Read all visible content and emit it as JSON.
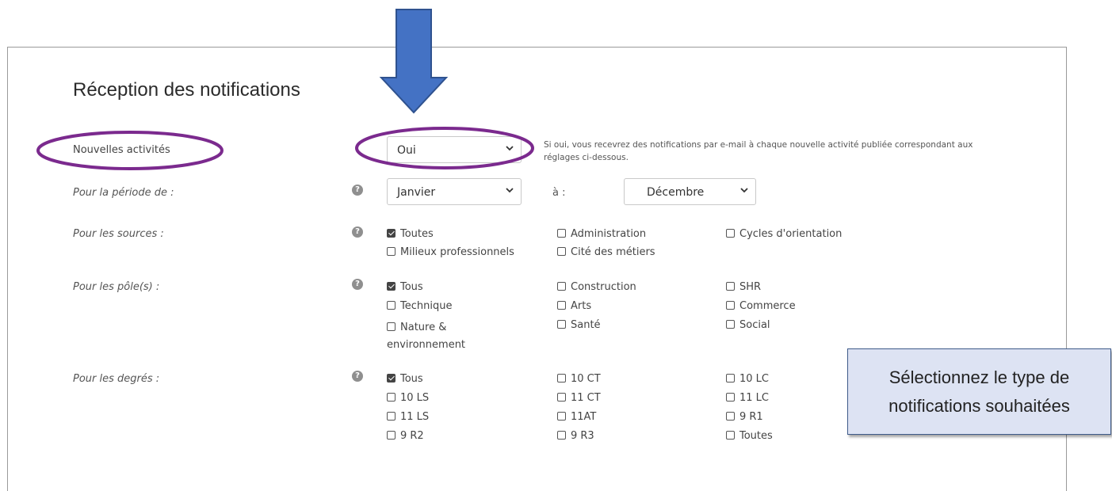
{
  "title": "Réception des notifications",
  "rows": {
    "nouvelles": {
      "label": "Nouvelles activités",
      "select_value": "Oui",
      "note": "Si oui, vous recevrez des notifications par e-mail à chaque nouvelle activité publiée correspondant aux réglages ci-dessous."
    },
    "periode": {
      "label": "Pour la période de :",
      "from_value": "Janvier",
      "separator": "à :",
      "to_value": "Décembre"
    },
    "sources": {
      "label": "Pour les sources :",
      "options": [
        {
          "label": "Toutes",
          "checked": true
        },
        {
          "label": "Administration",
          "checked": false
        },
        {
          "label": "Cycles d'orientation",
          "checked": false
        },
        {
          "label": "Milieux professionnels",
          "checked": false
        },
        {
          "label": "Cité des métiers",
          "checked": false
        }
      ]
    },
    "poles": {
      "label": "Pour les pôle(s) :",
      "options": [
        {
          "label": "Tous",
          "checked": true
        },
        {
          "label": "Construction",
          "checked": false
        },
        {
          "label": "SHR",
          "checked": false
        },
        {
          "label": "Technique",
          "checked": false
        },
        {
          "label": "Arts",
          "checked": false
        },
        {
          "label": "Commerce",
          "checked": false
        },
        {
          "label": "Nature & environnement",
          "checked": false
        },
        {
          "label": "Santé",
          "checked": false
        },
        {
          "label": "Social",
          "checked": false
        }
      ]
    },
    "degres": {
      "label": "Pour les degrés :",
      "options": [
        {
          "label": "Tous",
          "checked": true
        },
        {
          "label": "10 CT",
          "checked": false
        },
        {
          "label": "10 LC",
          "checked": false
        },
        {
          "label": "10 LS",
          "checked": false
        },
        {
          "label": "11 CT",
          "checked": false
        },
        {
          "label": "11 LC",
          "checked": false
        },
        {
          "label": "11 LS",
          "checked": false
        },
        {
          "label": "11AT",
          "checked": false
        },
        {
          "label": "9 R1",
          "checked": false
        },
        {
          "label": "9 R2",
          "checked": false
        },
        {
          "label": "9 R3",
          "checked": false
        },
        {
          "label": "Toutes",
          "checked": false
        }
      ]
    }
  },
  "help_icon": "question-mark-icon",
  "callout": {
    "line1": "Sélectionnez le type de",
    "line2": "notifications souhaitées"
  },
  "colors": {
    "arrow": "#4472c4",
    "arrow_border": "#2f528f",
    "ellipse": "#7b2a8e",
    "checked": "#444444"
  }
}
